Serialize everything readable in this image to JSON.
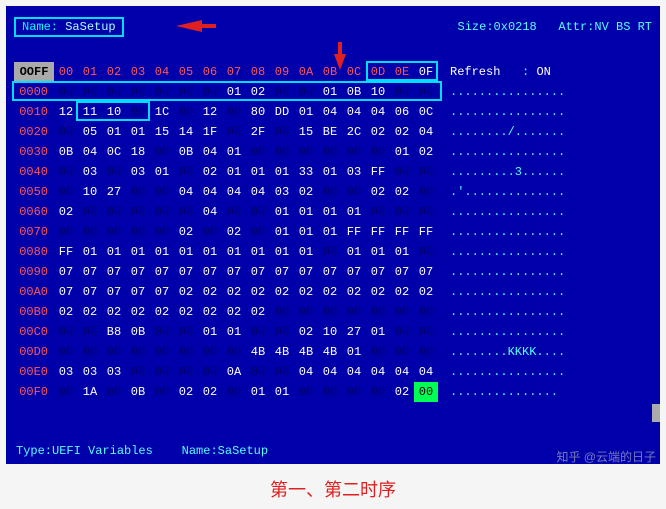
{
  "header": {
    "name_label": "Name:",
    "name_value": "SaSetup",
    "size_label": "Size:",
    "size_value": "0x0218",
    "attr_label": "Attr:",
    "attr_value": "NV BS RT"
  },
  "offsets_corner": "OOFF",
  "col_heads": [
    "00",
    "01",
    "02",
    "03",
    "04",
    "05",
    "06",
    "07",
    "08",
    "09",
    "0A",
    "0B",
    "0C",
    "0D",
    "0E",
    "0F"
  ],
  "refresh": {
    "label": "Refresh",
    "sep": ":",
    "value": "ON"
  },
  "rows": [
    {
      "addr": "0000",
      "bytes": [
        "00",
        "00",
        "00",
        "00",
        "00",
        "00",
        "00",
        "01",
        "02",
        "00",
        "00",
        "01",
        "0B",
        "10",
        "00",
        "00"
      ],
      "ascii": "................"
    },
    {
      "addr": "0010",
      "bytes": [
        "12",
        "11",
        "10",
        "00",
        "1C",
        "00",
        "12",
        "00",
        "80",
        "DD",
        "01",
        "04",
        "04",
        "04",
        "06",
        "0C"
      ],
      "ascii": "................"
    },
    {
      "addr": "0020",
      "bytes": [
        "00",
        "05",
        "01",
        "01",
        "15",
        "14",
        "1F",
        "00",
        "2F",
        "00",
        "15",
        "BE",
        "2C",
        "02",
        "02",
        "04"
      ],
      "ascii": "......../......."
    },
    {
      "addr": "0030",
      "bytes": [
        "0B",
        "04",
        "0C",
        "18",
        "00",
        "0B",
        "04",
        "01",
        "00",
        "00",
        "00",
        "00",
        "00",
        "00",
        "01",
        "02"
      ],
      "ascii": "................"
    },
    {
      "addr": "0040",
      "bytes": [
        "00",
        "03",
        "00",
        "03",
        "01",
        "00",
        "02",
        "01",
        "01",
        "01",
        "33",
        "01",
        "03",
        "FF",
        "00",
        "00"
      ],
      "ascii": ".........3......"
    },
    {
      "addr": "0050",
      "bytes": [
        "00",
        "10",
        "27",
        "00",
        "00",
        "04",
        "04",
        "04",
        "04",
        "03",
        "02",
        "00",
        "00",
        "02",
        "02",
        "00"
      ],
      "ascii": ".'.............."
    },
    {
      "addr": "0060",
      "bytes": [
        "02",
        "00",
        "00",
        "00",
        "00",
        "00",
        "04",
        "00",
        "00",
        "01",
        "01",
        "01",
        "01",
        "00",
        "00",
        "00"
      ],
      "ascii": "................"
    },
    {
      "addr": "0070",
      "bytes": [
        "00",
        "00",
        "00",
        "00",
        "00",
        "02",
        "00",
        "02",
        "00",
        "01",
        "01",
        "01",
        "FF",
        "FF",
        "FF",
        "FF"
      ],
      "ascii": "................"
    },
    {
      "addr": "0080",
      "bytes": [
        "FF",
        "01",
        "01",
        "01",
        "01",
        "01",
        "01",
        "01",
        "01",
        "01",
        "01",
        "00",
        "01",
        "01",
        "01",
        "00"
      ],
      "ascii": "................"
    },
    {
      "addr": "0090",
      "bytes": [
        "07",
        "07",
        "07",
        "07",
        "07",
        "07",
        "07",
        "07",
        "07",
        "07",
        "07",
        "07",
        "07",
        "07",
        "07",
        "07"
      ],
      "ascii": "................"
    },
    {
      "addr": "00A0",
      "bytes": [
        "07",
        "07",
        "07",
        "07",
        "07",
        "02",
        "02",
        "02",
        "02",
        "02",
        "02",
        "02",
        "02",
        "02",
        "02",
        "02"
      ],
      "ascii": "................"
    },
    {
      "addr": "00B0",
      "bytes": [
        "02",
        "02",
        "02",
        "02",
        "02",
        "02",
        "02",
        "02",
        "02",
        "00",
        "00",
        "00",
        "00",
        "00",
        "00",
        "00"
      ],
      "ascii": "................"
    },
    {
      "addr": "00C0",
      "bytes": [
        "00",
        "00",
        "B8",
        "0B",
        "00",
        "00",
        "01",
        "01",
        "00",
        "00",
        "02",
        "10",
        "27",
        "01",
        "00",
        "00"
      ],
      "ascii": "................"
    },
    {
      "addr": "00D0",
      "bytes": [
        "00",
        "00",
        "00",
        "00",
        "00",
        "00",
        "00",
        "00",
        "4B",
        "4B",
        "4B",
        "4B",
        "01",
        "00",
        "00",
        "00"
      ],
      "ascii": "........KKKK...."
    },
    {
      "addr": "00E0",
      "bytes": [
        "03",
        "03",
        "03",
        "00",
        "00",
        "00",
        "00",
        "0A",
        "00",
        "00",
        "04",
        "04",
        "04",
        "04",
        "04",
        "04"
      ],
      "ascii": "................"
    },
    {
      "addr": "00F0",
      "bytes": [
        "00",
        "1A",
        "00",
        "0B",
        "00",
        "02",
        "02",
        "00",
        "01",
        "01",
        "00",
        "00",
        "00",
        "00",
        "02",
        "00"
      ],
      "ascii": "...............",
      "inv_last": true
    }
  ],
  "footer": {
    "type_label": "Type:",
    "type_value": "UEFI Variables",
    "name_label": "Name:",
    "name_value": "SaSetup"
  },
  "caption": "第一、第二时序",
  "watermark": "知乎 @云端的日子"
}
